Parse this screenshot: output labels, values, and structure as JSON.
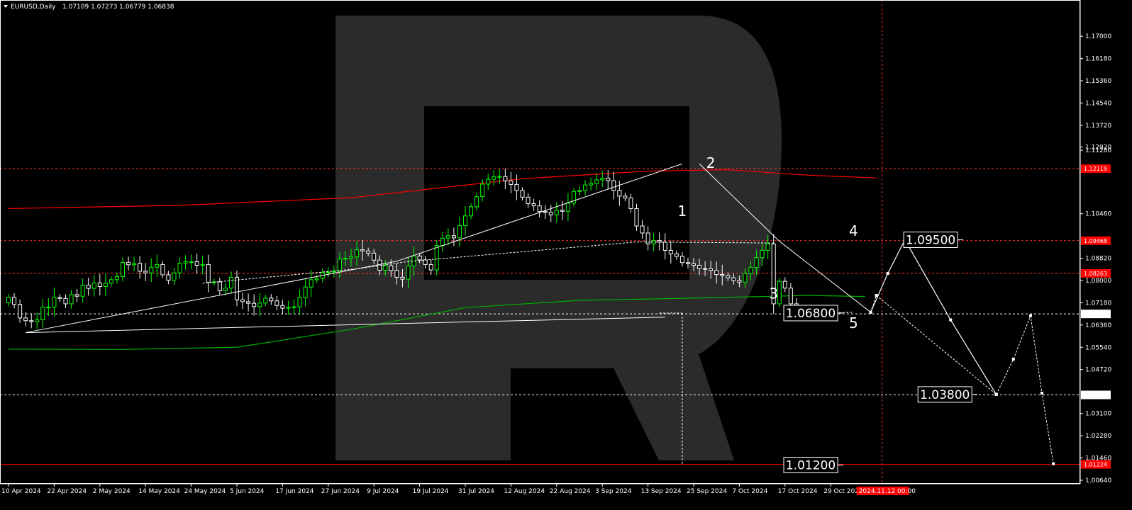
{
  "header": {
    "symbol": "EURUSD,Daily",
    "ohlc": "1.07109 1.07273 1.06779 1.06838"
  },
  "colors": {
    "background": "#000000",
    "bull": "#00ff00",
    "bear": "#ffffff",
    "ma_red": "#ff0000",
    "ma_green": "#00b000",
    "level_line": "#ff3333",
    "axis_text": "#ffffff",
    "price_tag_red": "#ff0000",
    "watermark": "#2b2b2b"
  },
  "chart_data": {
    "type": "candlestick",
    "symbol": "EURUSD",
    "timeframe": "Daily",
    "ylim": [
      1.0064,
      1.175
    ],
    "y_ticks": [
      1.17,
      1.1618,
      1.1536,
      1.1454,
      1.1372,
      1.1292,
      1.128,
      1.1046,
      1.0882,
      1.08,
      1.0718,
      1.0636,
      1.0554,
      1.0472,
      1.031,
      1.0228,
      1.0146,
      1.0064
    ],
    "y_tick_labels": [
      "1.17000",
      "1.16180",
      "1.15360",
      "1.14540",
      "1.13720",
      "1.12920",
      "1.11280",
      "1.10460",
      "1.08820",
      "1.08000",
      "1.07180",
      "1.06360",
      "1.05540",
      "1.04720",
      "1.03100",
      "1.02280",
      "1.01460",
      "1.00640"
    ],
    "x_labels": [
      "10 Apr 2024",
      "22 Apr 2024",
      "2 May 2024",
      "14 May 2024",
      "24 May 2024",
      "5 Jun 2024",
      "17 Jun 2024",
      "27 Jun 2024",
      "9 Jul 2024",
      "19 Jul 2024",
      "31 Jul 2024",
      "12 Aug 2024",
      "22 Aug 2024",
      "3 Sep 2024",
      "13 Sep 2024",
      "25 Sep 2024",
      "7 Oct 2024",
      "17 Oct 2024",
      "29 Oct 2024"
    ],
    "x_label_values": [
      0,
      8,
      16,
      24,
      32,
      40,
      48,
      56,
      64,
      72,
      80,
      88,
      96,
      104,
      112,
      120,
      128,
      136,
      144
    ],
    "current_time_label": "2024.11.12 00:00",
    "current_time_bar": 153,
    "closes": [
      1.0738,
      1.0712,
      1.0662,
      1.0652,
      1.0648,
      1.0655,
      1.0702,
      1.0702,
      1.0738,
      1.0734,
      1.0714,
      1.0748,
      1.0742,
      1.0783,
      1.0771,
      1.0791,
      1.0778,
      1.079,
      1.0803,
      1.0814,
      1.0867,
      1.0858,
      1.0863,
      1.0834,
      1.0828,
      1.0849,
      1.0859,
      1.0821,
      1.0801,
      1.0828,
      1.0864,
      1.0869,
      1.0869,
      1.0856,
      1.0859,
      1.0793,
      1.0795,
      1.0762,
      1.0772,
      1.0812,
      1.0729,
      1.0722,
      1.0716,
      1.0704,
      1.0717,
      1.0735,
      1.0725,
      1.0708,
      1.0698,
      1.0701,
      1.0703,
      1.0737,
      1.0776,
      1.0803,
      1.0808,
      1.0829,
      1.0831,
      1.0834,
      1.0879,
      1.0882,
      1.0887,
      1.0913,
      1.0909,
      1.0901,
      1.0875,
      1.0838,
      1.0854,
      1.0837,
      1.0812,
      1.0805,
      1.0853,
      1.089,
      1.0876,
      1.0859,
      1.0839,
      1.0929,
      1.0956,
      1.0965,
      1.0957,
      1.1002,
      1.1038,
      1.1072,
      1.1109,
      1.1155,
      1.1173,
      1.1182,
      1.1183,
      1.1167,
      1.1154,
      1.1132,
      1.1107,
      1.1083,
      1.1075,
      1.1054,
      1.1051,
      1.1042,
      1.1059,
      1.1055,
      1.1085,
      1.1128,
      1.1132,
      1.1152,
      1.1158,
      1.1171,
      1.1177,
      1.1168,
      1.1132,
      1.1111,
      1.1104,
      1.1065,
      1.1001,
      1.0975,
      1.0935,
      1.0947,
      1.0941,
      1.0911,
      1.0898,
      1.0889,
      1.0866,
      1.0862,
      1.0856,
      1.0844,
      1.0843,
      1.0837,
      1.0822,
      1.0818,
      1.081,
      1.08,
      1.0794,
      1.0825,
      1.0848,
      1.0884,
      1.0911,
      1.0935,
      1.0714,
      1.0797,
      1.0772,
      1.0714,
      1.0684
    ],
    "closes_note": "Approximate daily closes read from the chart; bars end at the last printed OHLC close.",
    "moving_averages": [
      {
        "color": "red",
        "points": [
          [
            0,
            1.1065
          ],
          [
            30,
            1.1077
          ],
          [
            60,
            1.1105
          ],
          [
            90,
            1.1175
          ],
          [
            112,
            1.1203
          ],
          [
            126,
            1.1208
          ],
          [
            140,
            1.1188
          ],
          [
            152,
            1.1178
          ]
        ]
      },
      {
        "color": "green",
        "points": [
          [
            0,
            1.0547
          ],
          [
            20,
            1.0546
          ],
          [
            40,
            1.0554
          ],
          [
            60,
            1.062
          ],
          [
            80,
            1.07
          ],
          [
            100,
            1.0727
          ],
          [
            120,
            1.0735
          ],
          [
            140,
            1.0745
          ],
          [
            150,
            1.0741
          ]
        ]
      }
    ],
    "levels": [
      {
        "value": 1.12119,
        "tag": "1.12119",
        "style": "dashed",
        "color": "#ff3333"
      },
      {
        "value": 1.09468,
        "tag": "1.09468",
        "style": "dashed",
        "color": "#ff3333"
      },
      {
        "value": 1.08263,
        "tag": "1.08263",
        "style": "dashed",
        "color": "#ff3333"
      },
      {
        "value": 1.06769,
        "tag": "1.06769",
        "style": "dashed",
        "color": "#ffffff"
      },
      {
        "value": 1.03784,
        "tag": "1.03784",
        "style": "dashed",
        "color": "#ffffff"
      },
      {
        "value": 1.01224,
        "tag": "1.01224",
        "style": "solid",
        "color": "#ff0000"
      }
    ],
    "wave_labels": [
      {
        "text": "1",
        "x": 118,
        "y": 1.1037
      },
      {
        "text": "2",
        "x": 123,
        "y": 1.1215
      },
      {
        "text": "3",
        "x": 134,
        "y": 1.0733
      },
      {
        "text": "4",
        "x": 148,
        "y": 1.0965
      },
      {
        "text": "5",
        "x": 148,
        "y": 1.0625
      }
    ],
    "targets": [
      {
        "label": "1.09500",
        "value": 1.095,
        "x": 161.5
      },
      {
        "label": "1.06800",
        "value": 1.068,
        "x": 140.5
      },
      {
        "label": "1.03800",
        "value": 1.038,
        "x": 164.0
      },
      {
        "label": "1.01200",
        "value": 1.012,
        "x": 140.5
      }
    ],
    "trend_lines": [
      {
        "style": "solid",
        "points": [
          [
            3,
            1.0608
          ],
          [
            61,
            1.0843
          ],
          [
            68,
            1.0871
          ],
          [
            118,
            1.123
          ]
        ]
      },
      {
        "style": "solid",
        "points": [
          [
            3,
            1.0608
          ],
          [
            115,
            1.0665
          ]
        ]
      },
      {
        "style": "dashed",
        "points": [
          [
            34,
            1.079
          ],
          [
            61,
            1.0843
          ],
          [
            70,
            1.087
          ],
          [
            110,
            1.0942
          ],
          [
            134,
            1.0938
          ]
        ]
      },
      {
        "style": "solid",
        "points": [
          [
            121,
            1.123
          ],
          [
            135,
            1.0945
          ],
          [
            151,
            1.0683
          ]
        ]
      },
      {
        "style": "dashed",
        "points": [
          [
            118,
            1.068
          ],
          [
            118,
            1.012
          ]
        ]
      },
      {
        "style": "dashed",
        "points": [
          [
            114,
            1.068
          ],
          [
            118,
            1.068
          ]
        ]
      },
      {
        "style": "dashed",
        "points": [
          [
            143,
            1.068
          ],
          [
            148,
            1.0683
          ]
        ]
      }
    ],
    "forecast_path": {
      "solid": [
        [
          151,
          1.0683
        ],
        [
          154,
          1.0826
        ],
        [
          157,
          1.095
        ],
        [
          165,
          1.0655
        ],
        [
          173,
          1.038
        ]
      ],
      "dashed": [
        [
          151,
          1.0683
        ],
        [
          152,
          1.0745
        ],
        [
          173,
          1.038
        ],
        [
          176,
          1.051
        ],
        [
          179,
          1.067
        ],
        [
          181,
          1.0385
        ],
        [
          183,
          1.0125
        ]
      ]
    }
  }
}
